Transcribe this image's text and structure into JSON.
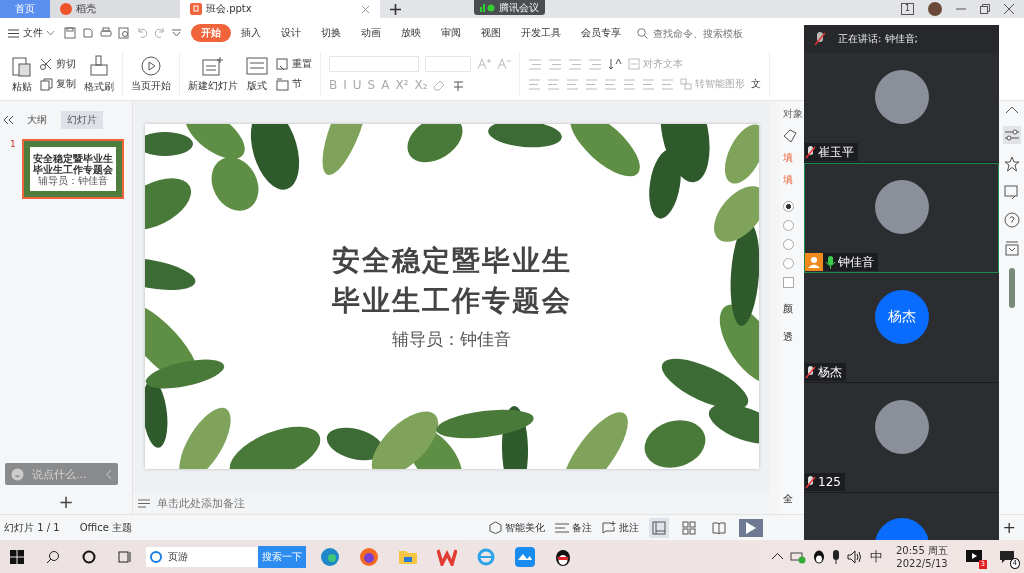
{
  "tabs": [
    {
      "label": "首页",
      "kind": "home",
      "selected": false
    },
    {
      "label": "稻壳",
      "kind": "app",
      "selected": false
    },
    {
      "label": "班会.pptx",
      "kind": "document",
      "selected": true
    }
  ],
  "meeting_badge": "腾讯会议",
  "screen_count": "1",
  "menu": {
    "file": "文件",
    "ribbon_tabs": [
      {
        "label": "开始",
        "selected": true
      },
      {
        "label": "插入",
        "selected": false
      },
      {
        "label": "设计",
        "selected": false
      },
      {
        "label": "切换",
        "selected": false
      },
      {
        "label": "动画",
        "selected": false
      },
      {
        "label": "放映",
        "selected": false
      },
      {
        "label": "审阅",
        "selected": false
      },
      {
        "label": "视图",
        "selected": false
      },
      {
        "label": "开发工具",
        "selected": false
      },
      {
        "label": "会员专享",
        "selected": false
      }
    ],
    "search_placeholder": "查找命令、搜索模板"
  },
  "ribbon": {
    "paste": "粘贴",
    "cut": "剪切",
    "copy": "复制",
    "format_painter": "格式刷",
    "play_from_current": "当页开始",
    "new_slide": "新建幻灯片",
    "layout": "版式",
    "reset": "重置",
    "section": "节",
    "format_buttons": [
      "B",
      "I",
      "U",
      "S",
      "A",
      "X²",
      "X₂"
    ],
    "align_text": "对齐文本",
    "smart_art": "转智能图形",
    "cut_off_label": "文"
  },
  "left_panel": {
    "tabs": [
      {
        "label": "大纲",
        "selected": false
      },
      {
        "label": "幻灯片",
        "selected": true
      }
    ],
    "slides": [
      {
        "number": "1",
        "selected": true,
        "lines": [
          "安全稳定暨毕业生",
          "毕业生工作专题会",
          "辅导员：钟佳音"
        ]
      }
    ],
    "chat_placeholder": "说点什么...",
    "add_button": "+"
  },
  "slide": {
    "title_lines": [
      "安全稳定暨毕业生",
      "毕业生工作专题会"
    ],
    "subtitle": "辅导员：钟佳音"
  },
  "notes_placeholder": "单击此处添加备注",
  "properties_panel": {
    "heading": "对象",
    "tab": "填",
    "section": "填",
    "radios": [
      {
        "checked": true
      },
      {
        "checked": false
      },
      {
        "checked": false
      },
      {
        "checked": false
      }
    ],
    "checkbox": {
      "checked": false
    },
    "labels": [
      "颜",
      "透"
    ],
    "footer": "全"
  },
  "status_bar": {
    "slide_count": "幻灯片 1 / 1",
    "theme": "Office 主题",
    "beautify": "智能美化",
    "notes": "备注",
    "comments": "批注",
    "views": [
      {
        "selected": true
      },
      {
        "selected": false
      },
      {
        "selected": false
      }
    ],
    "add_button": "+"
  },
  "meeting": {
    "speaking": "正在讲话: 钟佳音;",
    "participants": [
      {
        "name": "崔玉平",
        "muted": true,
        "kind": "photo",
        "speaking": false,
        "host": false
      },
      {
        "name": "钟佳音",
        "muted": false,
        "kind": "photo",
        "speaking": true,
        "host": true
      },
      {
        "name": "杨杰",
        "muted": true,
        "kind": "initials",
        "avatar_text": "杨杰",
        "speaking": false,
        "host": false
      },
      {
        "name": "125",
        "muted": true,
        "kind": "photo",
        "speaking": false,
        "host": false
      }
    ]
  },
  "taskbar": {
    "search_text": "页游",
    "search_button": "搜索一下",
    "ime": "中",
    "time": "20:55 周五",
    "date": "2022/5/13",
    "badges": [
      "3",
      "4"
    ]
  }
}
